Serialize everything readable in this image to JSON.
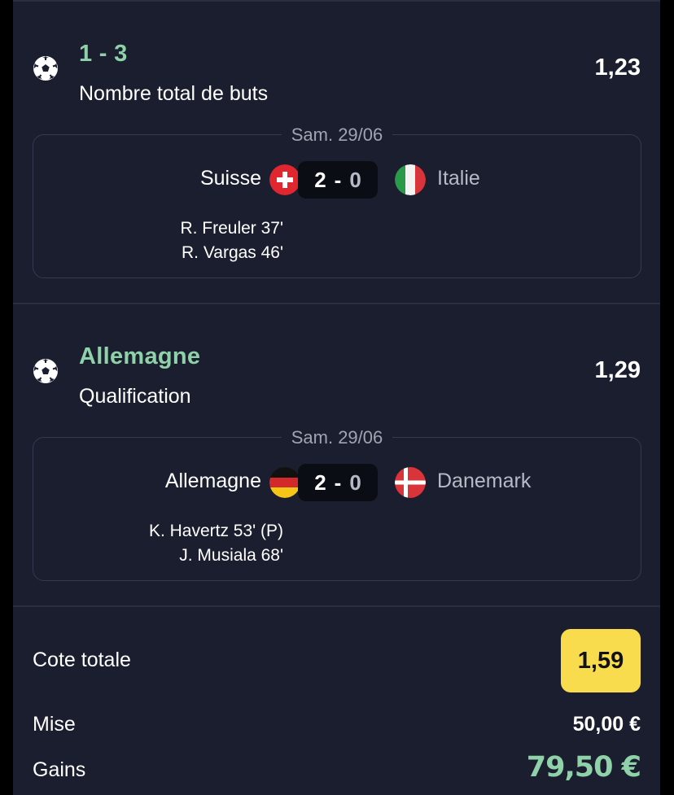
{
  "selections": [
    {
      "pick": "1 - 3",
      "market": "Nombre total de buts",
      "odds": "1,23",
      "date": "Sam. 29/06",
      "home": "Suisse",
      "away": "Italie",
      "home_score": "2",
      "away_score": "0",
      "scorers": [
        "R. Freuler 37'",
        "R. Vargas 46'"
      ]
    },
    {
      "pick": "Allemagne",
      "market": "Qualification",
      "odds": "1,29",
      "date": "Sam. 29/06",
      "home": "Allemagne",
      "away": "Danemark",
      "home_score": "2",
      "away_score": "0",
      "scorers": [
        "K. Havertz 53' (P)",
        "J. Musiala 68'"
      ]
    }
  ],
  "summary": {
    "total_odds_label": "Cote totale",
    "total_odds": "1,59",
    "stake_label": "Mise",
    "stake": "50,00 €",
    "gains_label": "Gains",
    "gains": "79,50 €"
  },
  "colors": {
    "background": "#1a1e2e",
    "accent_green": "#8fd1a8",
    "odds_yellow": "#f8dc4e"
  },
  "icons": [
    "soccer-ball-icon",
    "flag-switzerland",
    "flag-italy",
    "flag-germany",
    "flag-denmark"
  ]
}
